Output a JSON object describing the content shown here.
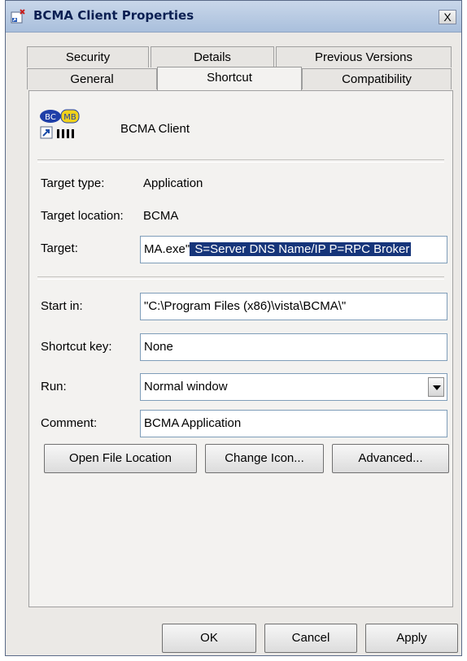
{
  "window": {
    "title": "BCMA Client Properties",
    "close_glyph": "X"
  },
  "tabs": {
    "row_back": [
      "Security",
      "Details",
      "Previous Versions"
    ],
    "row_front": [
      "General",
      "Shortcut",
      "Compatibility"
    ],
    "active": "Shortcut"
  },
  "shortcut": {
    "icon_text": {
      "left": "BC",
      "right": "MB"
    },
    "name": "BCMA Client",
    "target_type_label": "Target type:",
    "target_type_value": "Application",
    "target_location_label": "Target location:",
    "target_location_value": "BCMA",
    "target_label": "Target:",
    "target_value_plain": "MA.exe\"",
    "target_value_selected": " S=Server DNS Name/IP P=RPC Broker",
    "start_in_label": "Start in:",
    "start_in_value": "\"C:\\Program Files (x86)\\vista\\BCMA\\\"",
    "shortcut_key_label": "Shortcut key:",
    "shortcut_key_value": "None",
    "run_label": "Run:",
    "run_value": "Normal window",
    "comment_label": "Comment:",
    "comment_value": "BCMA Application",
    "buttons": {
      "open_location": "Open File Location",
      "change_icon": "Change Icon...",
      "advanced": "Advanced..."
    }
  },
  "footer": {
    "ok": "OK",
    "cancel": "Cancel",
    "apply": "Apply"
  },
  "colors": {
    "selection": "#16357a",
    "title_text": "#0b1f52",
    "dialog_bg": "#ebe9e6"
  }
}
